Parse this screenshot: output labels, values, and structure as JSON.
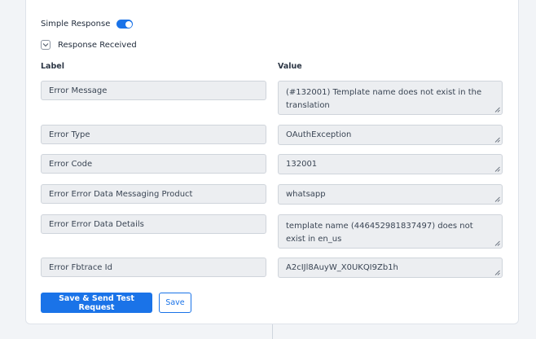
{
  "simple_response": {
    "label": "Simple Response",
    "enabled": true
  },
  "response_section": {
    "label": "Response Received"
  },
  "columns": {
    "label": "Label",
    "value": "Value"
  },
  "rows": [
    {
      "label": "Error Message",
      "value": "(#132001) Template name does not exist in the translation"
    },
    {
      "label": "Error Type",
      "value": "OAuthException"
    },
    {
      "label": "Error Code",
      "value": "132001"
    },
    {
      "label": "Error Error Data Messaging Product",
      "value": "whatsapp"
    },
    {
      "label": "Error Error Data Details",
      "value": "template name (446452981837497) does not exist in en_us"
    },
    {
      "label": "Error Fbtrace Id",
      "value": "A2cIJl8AuyW_X0UKQI9Zb1h"
    }
  ],
  "buttons": {
    "primary": "Save & Send Test Request",
    "secondary": "Save"
  },
  "colors": {
    "accent": "#1a73e8"
  }
}
